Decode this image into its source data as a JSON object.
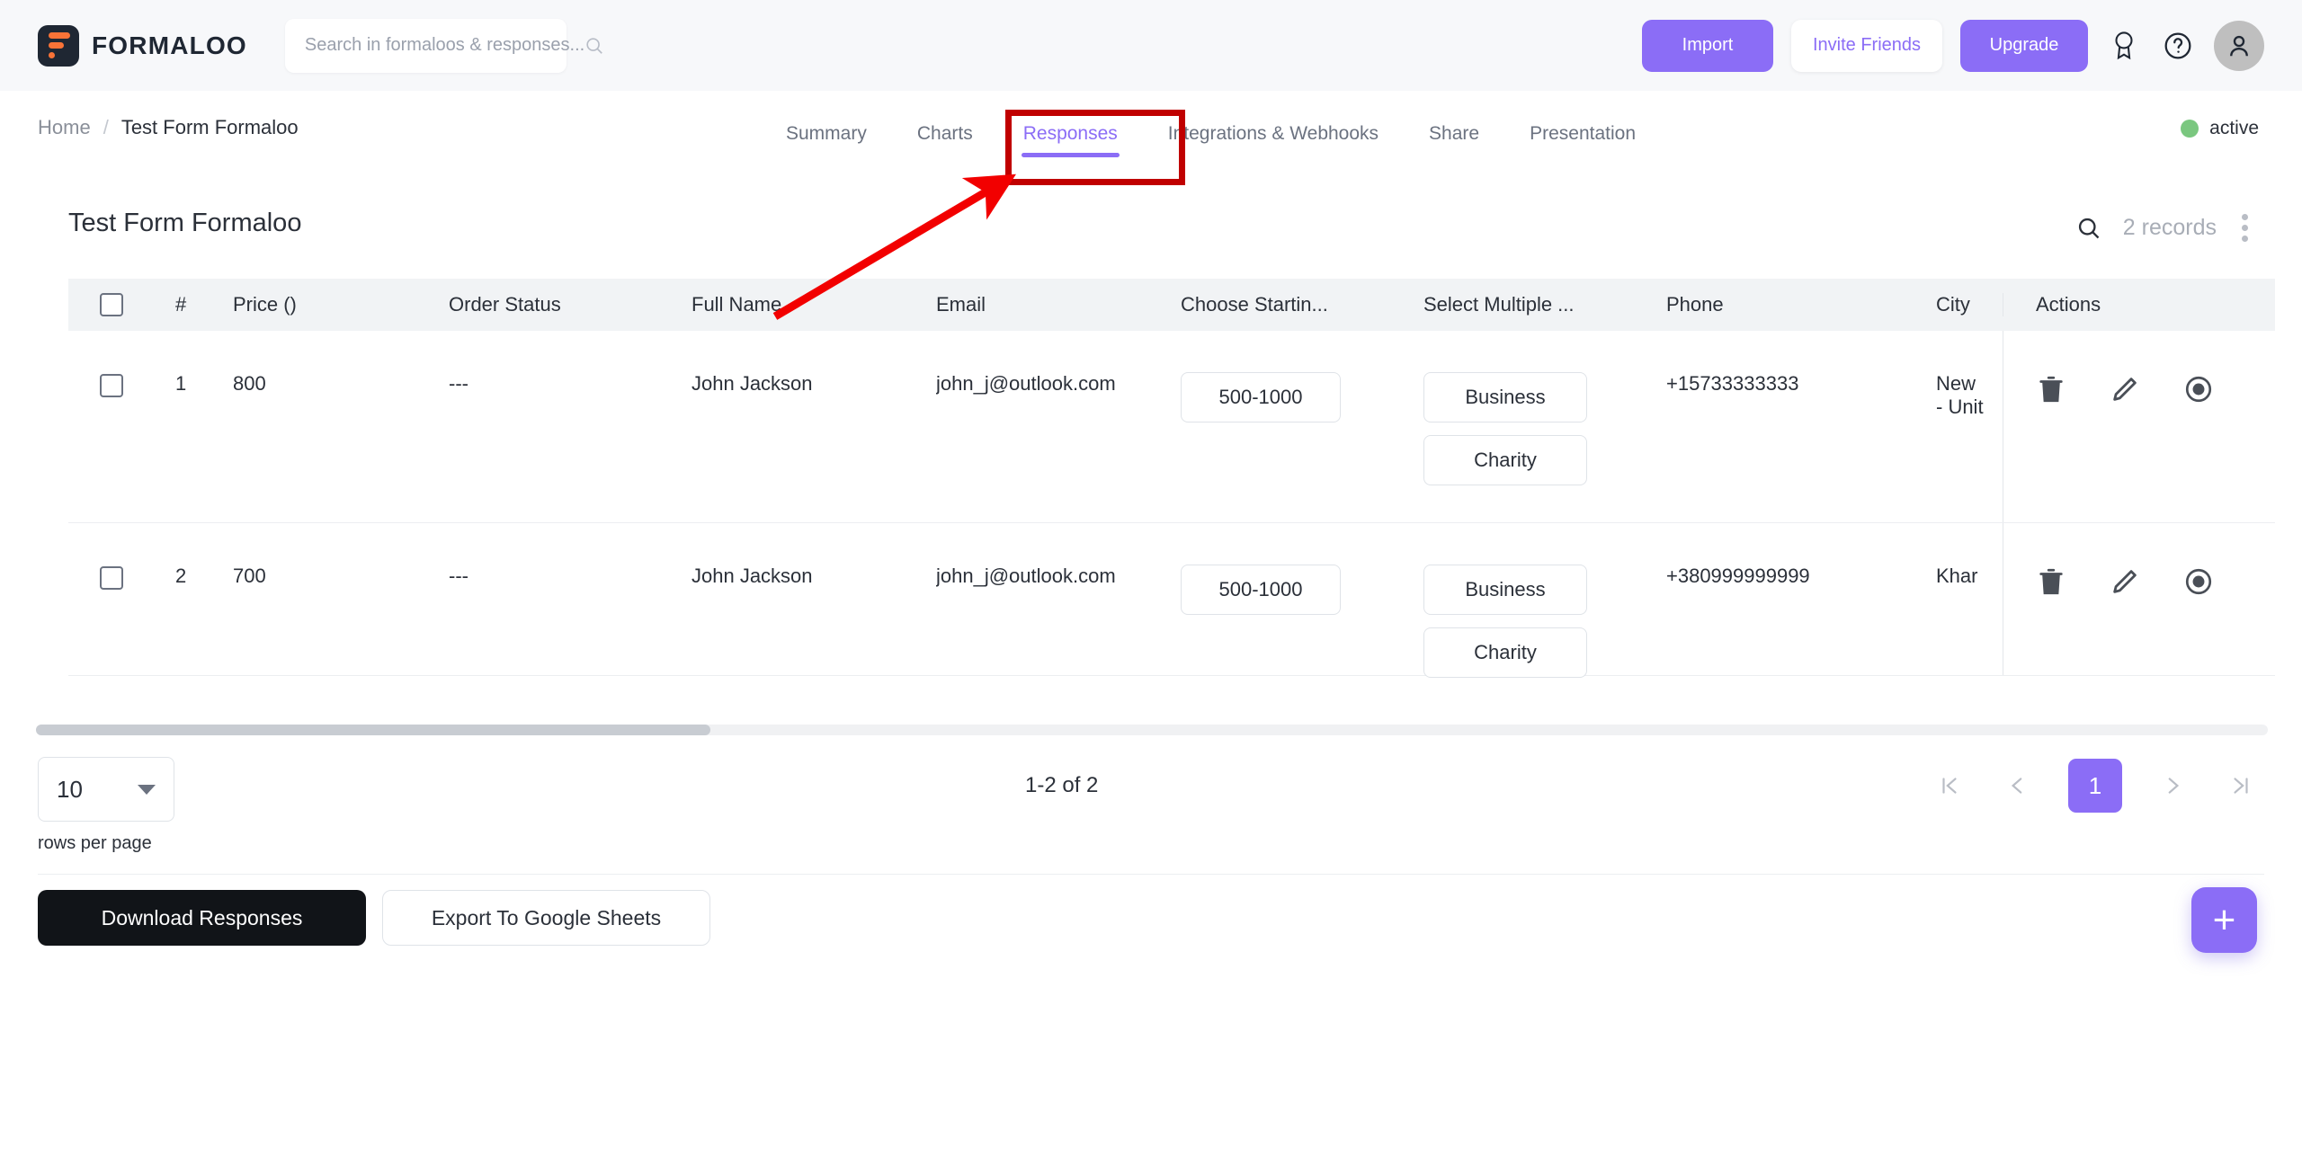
{
  "header": {
    "brand_name": "FORMALOO",
    "search": {
      "placeholder": "Search in formaloos & responses...",
      "value": ""
    },
    "import_label": "Import",
    "invite_label": "Invite Friends",
    "upgrade_label": "Upgrade",
    "accent_purple": "#8b6df6",
    "brand_orange": "#f97337"
  },
  "breadcrumb": {
    "home": "Home",
    "separator": "/",
    "current": "Test Form Formaloo"
  },
  "tabs": [
    {
      "label": "Summary",
      "active": false
    },
    {
      "label": "Charts",
      "active": false
    },
    {
      "label": "Responses",
      "active": true
    },
    {
      "label": "Integrations & Webhooks",
      "active": false
    },
    {
      "label": "Share",
      "active": false
    },
    {
      "label": "Presentation",
      "active": false
    }
  ],
  "status": {
    "label": "active",
    "color": "#7ac77f"
  },
  "title_row": {
    "title": "Test Form Formaloo",
    "records": "2 records"
  },
  "table": {
    "columns": [
      "#",
      "Price ()",
      "Order Status",
      "Full Name",
      "Email",
      "Choose Startin...",
      "Select Multiple ...",
      "Phone",
      "City",
      "Actions"
    ],
    "rows": [
      {
        "num": "1",
        "price": "800",
        "order_status": "---",
        "full_name": "John Jackson",
        "email": "john_j@outlook.com",
        "choose_starting": [
          "500-1000"
        ],
        "select_multiple": [
          "Business",
          "Charity"
        ],
        "phone": "+15733333333",
        "city_line1": "New ",
        "city_line2": "- Unit"
      },
      {
        "num": "2",
        "price": "700",
        "order_status": "---",
        "full_name": "John Jackson",
        "email": "john_j@outlook.com",
        "choose_starting": [
          "500-1000"
        ],
        "select_multiple": [
          "Business",
          "Charity"
        ],
        "phone": "+380999999999",
        "city_line1": "Khar",
        "city_line2": ""
      }
    ]
  },
  "pagination": {
    "rows_per_page_value": "10",
    "rows_per_page_label": "rows per page",
    "range": "1-2 of 2",
    "current_page": "1"
  },
  "footer": {
    "download_label": "Download Responses",
    "export_label": "Export To Google Sheets",
    "fab_label": "+"
  },
  "annotation": {
    "color": "#c00000",
    "target_tab": "Responses"
  }
}
